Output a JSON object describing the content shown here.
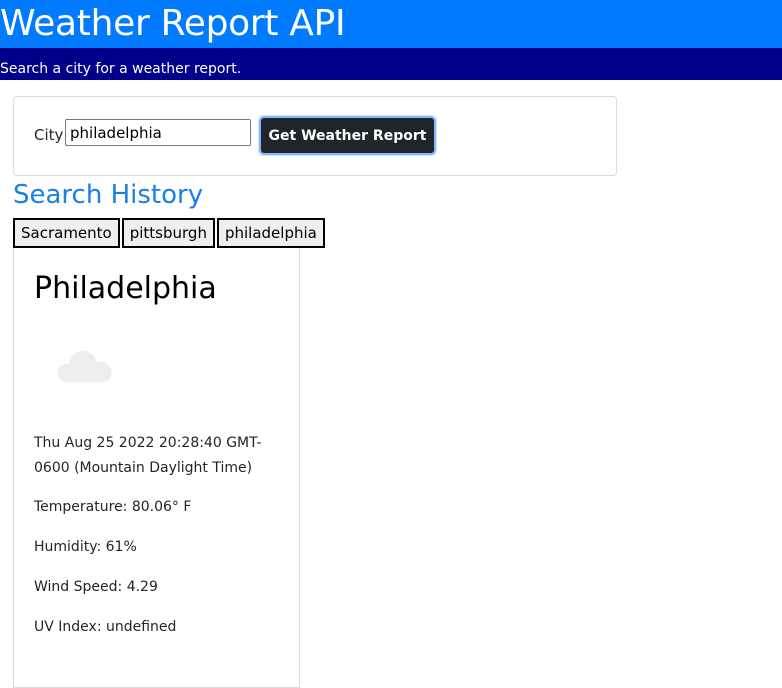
{
  "header": {
    "title": "Weather Report API",
    "subtitle": "Search a city for a weather report."
  },
  "search": {
    "city_label": "City",
    "city_value": "philadelphia",
    "button_label": "Get Weather Report"
  },
  "history": {
    "heading": "Search History",
    "items": [
      {
        "label": "Sacramento"
      },
      {
        "label": "pittsburgh"
      },
      {
        "label": "philadelphia"
      }
    ]
  },
  "weather": {
    "city": "Philadelphia",
    "icon": "cloud-icon",
    "date": "Thu Aug 25 2022 20:28:40 GMT-0600 (Mountain Daylight Time)",
    "temperature": "Temperature: 80.06° F",
    "humidity": "Humidity: 61%",
    "wind_speed": "Wind Speed: 4.29",
    "uv_index": "UV Index: undefined"
  },
  "colors": {
    "header_bg": "#007bff",
    "subbar_bg": "#00008b",
    "button_bg": "#212529",
    "heading_accent": "#1c7fe5"
  }
}
